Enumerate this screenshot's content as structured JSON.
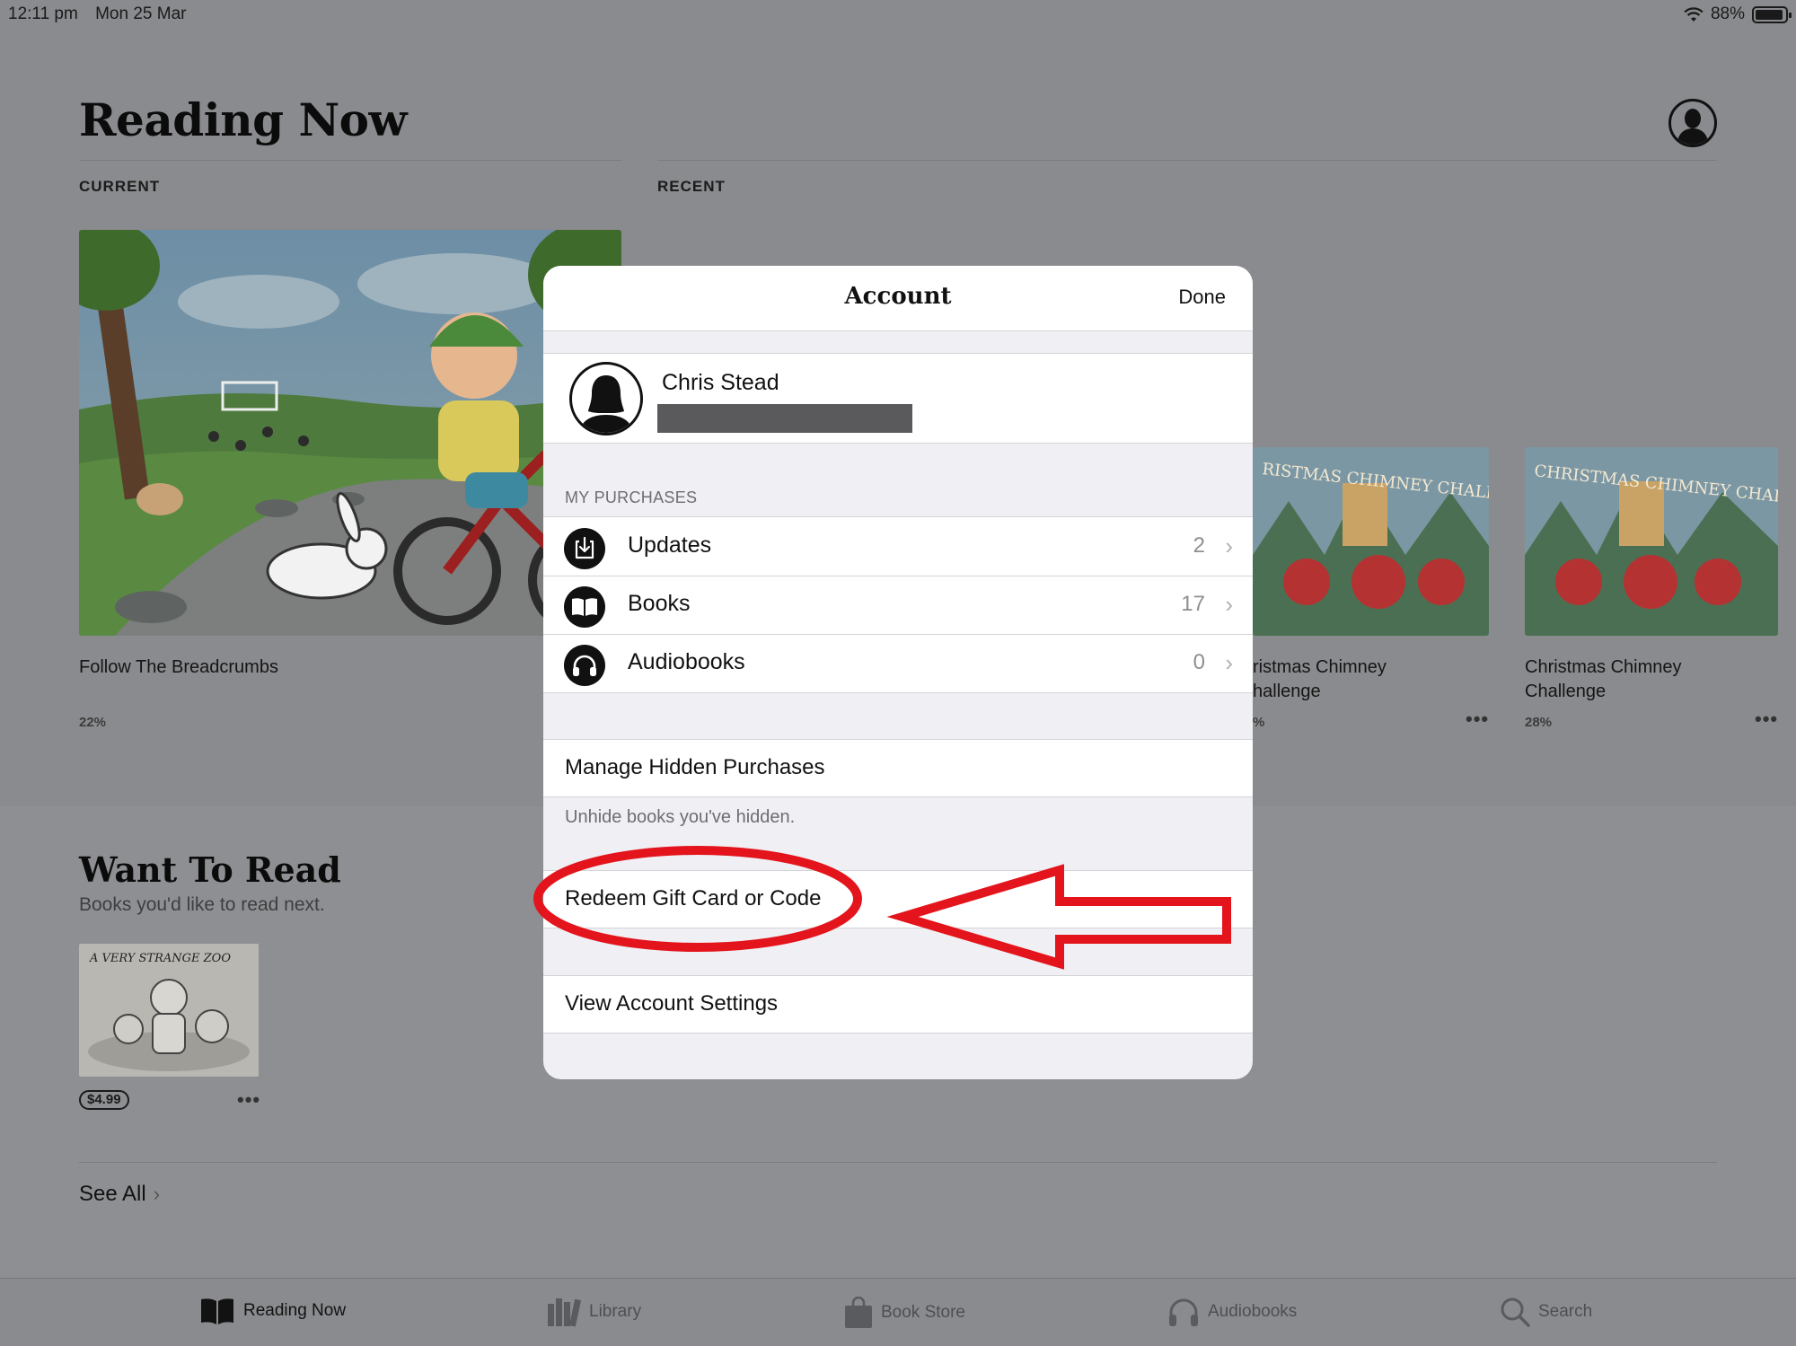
{
  "status_bar": {
    "time": "12:11 pm",
    "date": "Mon 25 Mar",
    "battery": "88%",
    "battery_level": 0.88
  },
  "page": {
    "title": "Reading Now"
  },
  "sections": {
    "current": "CURRENT",
    "recent": "RECENT"
  },
  "current_book": {
    "title": "Follow The Breadcrumbs",
    "progress": "22%"
  },
  "recent_books": [
    {
      "title": "Christmas Chimney Challenge",
      "visible_title": "ristmas Chimney\nhallenge",
      "progress": "%"
    },
    {
      "title": "Christmas Chimney Challenge",
      "progress": "28%"
    }
  ],
  "want_to_read": {
    "title": "Want To Read",
    "subtitle": "Books you'd like to read next.",
    "price": "$4.99",
    "cover_text": "A VERY STRANGE ZOO",
    "see_all": "See All"
  },
  "tabs": [
    {
      "label": "Reading Now",
      "icon": "book-open-icon",
      "active": true
    },
    {
      "label": "Library",
      "icon": "library-icon",
      "active": false
    },
    {
      "label": "Book Store",
      "icon": "shopping-bag-icon",
      "active": false
    },
    {
      "label": "Audiobooks",
      "icon": "headphones-icon",
      "active": false
    },
    {
      "label": "Search",
      "icon": "search-icon",
      "active": false
    }
  ],
  "modal": {
    "title": "Account",
    "done": "Done",
    "user_name": "Chris Stead",
    "purchases_header": "MY PURCHASES",
    "purchases": [
      {
        "label": "Updates",
        "count": "2",
        "icon": "download-icon"
      },
      {
        "label": "Books",
        "count": "17",
        "icon": "book-icon"
      },
      {
        "label": "Audiobooks",
        "count": "0",
        "icon": "headphones-icon"
      }
    ],
    "manage_hidden": "Manage Hidden Purchases",
    "manage_hidden_note": "Unhide books you've hidden.",
    "redeem": "Redeem Gift Card or Code",
    "view_settings": "View Account Settings"
  },
  "annotation": {
    "color": "#e3141b"
  }
}
